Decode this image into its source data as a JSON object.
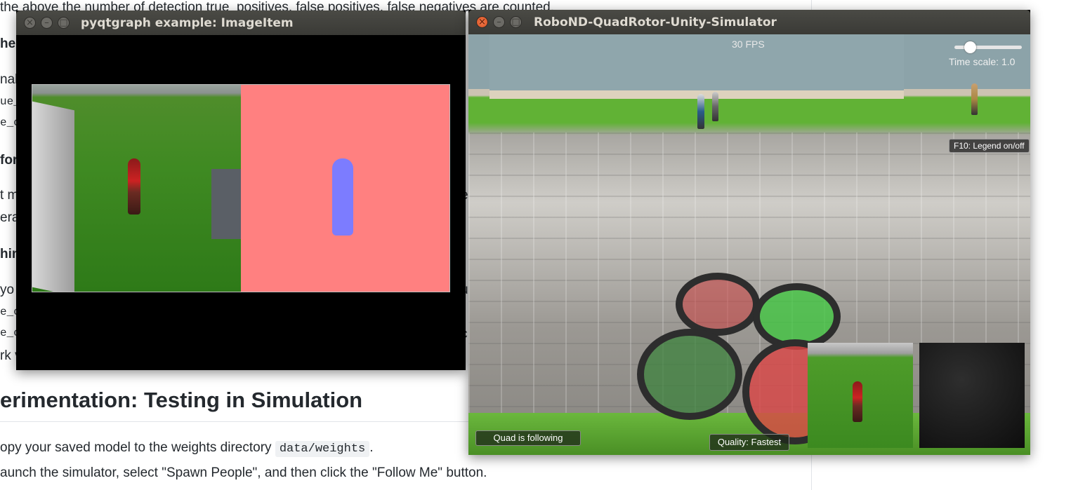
{
  "background_doc": {
    "line_top": "the above the number of detection true_positives, false positives, false negatives are counted.",
    "left_fragments": [
      "he",
      "nal",
      "ue_",
      "e_c",
      "for",
      "t m",
      "era",
      "hin",
      "yo",
      "e_c",
      "e_c",
      "rk v"
    ],
    "right_fragments": [
      "e",
      "u",
      "l",
      "c"
    ],
    "heading": "erimentation: Testing in Simulation",
    "step1_text": "opy your saved model to the weights directory",
    "step1_code": "data/weights",
    "step1_tail": ".",
    "step2_text": "aunch the simulator, select \"Spawn People\", and then click the \"Follow Me\" button."
  },
  "pyqt_window": {
    "title": "pyqtgraph example: ImageItem",
    "close_glyph": "×",
    "minimize_glyph": "–",
    "maximize_glyph": "□"
  },
  "sim_window": {
    "title": "RoboND-QuadRotor-Unity-Simulator",
    "close_glyph": "×",
    "minimize_glyph": "–",
    "maximize_glyph": "□",
    "fps": "30 FPS",
    "time_scale": "Time scale: 1.0",
    "time_scale_value": 1.0,
    "legend_button": "F10: Legend on/off",
    "following_status": "Quad is following",
    "quality_status": "Quality: Fastest"
  },
  "colors": {
    "titlebar": "#3c3b37",
    "close_button": "#e0552a",
    "mask_background": "#ff8080",
    "mask_person": "#7c7cff"
  }
}
